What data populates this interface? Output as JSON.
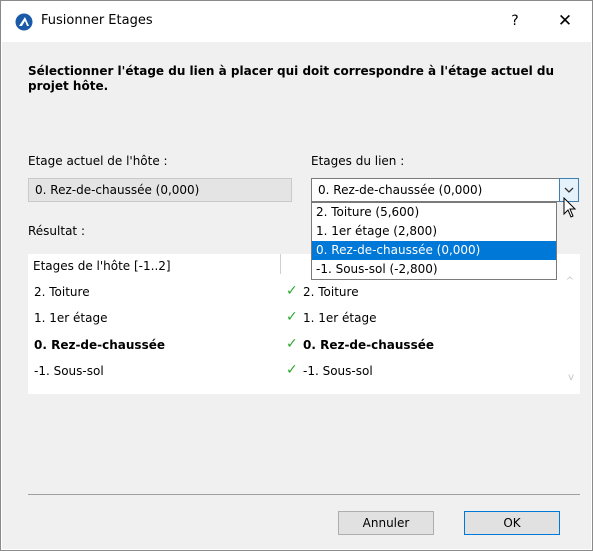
{
  "window": {
    "title": "Fusionner Etages",
    "help": "?",
    "close": "✕"
  },
  "instruction": "Sélectionner l'étage du lien à placer qui doit correspondre à l'étage actuel du projet hôte.",
  "host_floor": {
    "label": "Etage actuel de l'hôte :",
    "value": "0. Rez-de-chaussée (0,000)"
  },
  "link_floor": {
    "label": "Etages du lien :",
    "value": "0. Rez-de-chaussée (0,000)",
    "options": [
      "2. Toiture (5,600)",
      "1. 1er étage (2,800)",
      "0. Rez-de-chaussée (0,000)",
      "-1. Sous-sol (-2,800)"
    ],
    "selected_index": 2
  },
  "result": {
    "label": "Résultat :",
    "host_header": "Etages de l'hôte [-1..2]",
    "rows": [
      {
        "host": "2. Toiture",
        "link": "2. Toiture",
        "check": "✓"
      },
      {
        "host": "1. 1er étage",
        "link": "1. 1er étage",
        "check": "✓"
      },
      {
        "host": "0. Rez-de-chaussée",
        "link": "0. Rez-de-chaussée",
        "check": "✓"
      },
      {
        "host": "-1. Sous-sol",
        "link": "-1. Sous-sol",
        "check": "✓"
      }
    ],
    "scroll_up": "^",
    "scroll_down": "v"
  },
  "buttons": {
    "cancel": "Annuler",
    "ok": "OK"
  },
  "colors": {
    "selection": "#0078d7",
    "check": "#2fa82f",
    "app_icon": "#1a5aa8"
  },
  "icons": {
    "app": "archicad-logo-icon",
    "dropdown": "chevron-down-icon",
    "pointer": "mouse-cursor-icon"
  }
}
